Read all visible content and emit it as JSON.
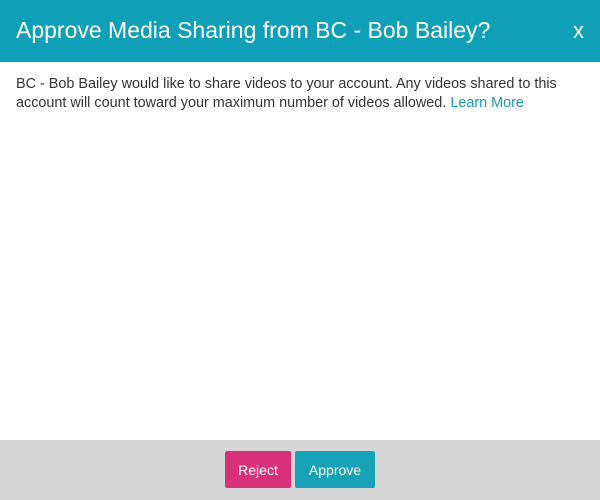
{
  "dialog": {
    "title": "Approve Media Sharing from BC - Bob Bailey?",
    "close_label": "x",
    "message": "BC - Bob Bailey would like to share videos to your account. Any videos shared to this account will count toward your maximum number of videos allowed.",
    "learn_more_label": "Learn More"
  },
  "footer": {
    "reject_label": "Reject",
    "approve_label": "Approve"
  },
  "colors": {
    "header_bg": "#0fa0b8",
    "reject_bg": "#d9307a",
    "approve_bg": "#17a2b8",
    "link": "#1a9bb3",
    "footer_bg": "#d6d6d6"
  }
}
